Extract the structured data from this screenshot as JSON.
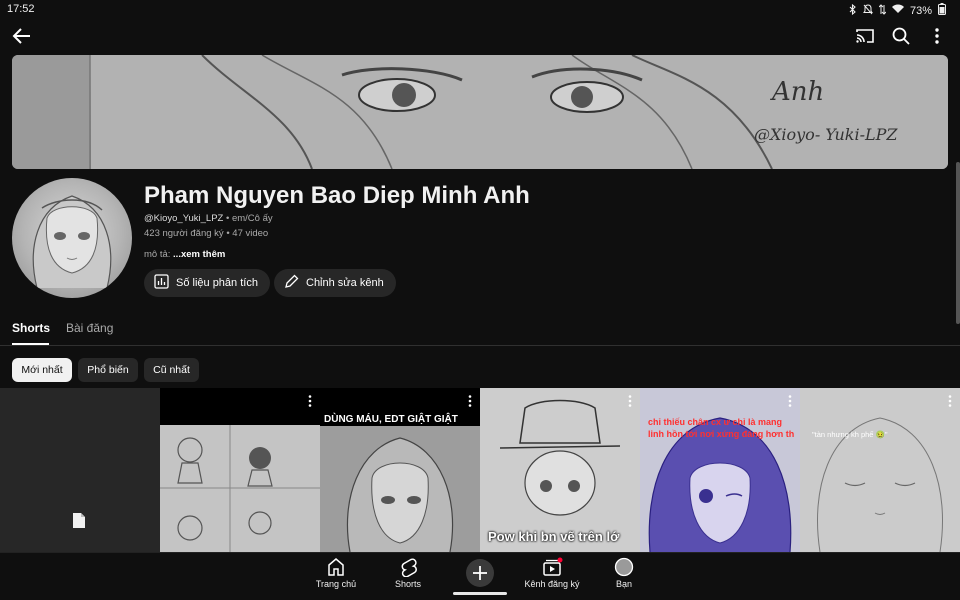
{
  "status": {
    "time": "17:52",
    "battery": "73%"
  },
  "channel": {
    "name": "Pham Nguyen Bao Diep Minh Anh",
    "handle": "@Kioyo_Yuki_LPZ",
    "pronoun": "em/Cô ấy",
    "subscribers": "423 người đăng ký",
    "videos": "47 video",
    "desc_label": "mô tả:",
    "desc_more": "...xem thêm",
    "banner_signature": "@Xioyo- Yuki-LPZ"
  },
  "actions": {
    "analytics": "Số liệu phân tích",
    "edit": "Chỉnh sửa kênh"
  },
  "tabs": [
    "Shorts",
    "Bài đăng"
  ],
  "filters": [
    "Mới nhất",
    "Phổ biến",
    "Cũ nhất"
  ],
  "shorts": [
    {
      "caption": ""
    },
    {
      "caption": ""
    },
    {
      "caption": "DÙNG MÁU, EDT GIẬT GIẬT"
    },
    {
      "caption": "Pow khi bn vẽ trên lớ"
    },
    {
      "caption": "chỉ thiếu chân cx ư chỉ là mang linh hồn tới nơi xứng đáng hơn th"
    },
    {
      "caption": "\"tàn nhưng kh phế 🤢\""
    }
  ],
  "nav": [
    {
      "label": "Trang chủ",
      "icon": "home-icon"
    },
    {
      "label": "Shorts",
      "icon": "shorts-icon"
    },
    {
      "label": "",
      "icon": "create-icon"
    },
    {
      "label": "Kênh đăng ký",
      "icon": "subscriptions-icon"
    },
    {
      "label": "Bạn",
      "icon": "you-avatar-icon"
    }
  ]
}
